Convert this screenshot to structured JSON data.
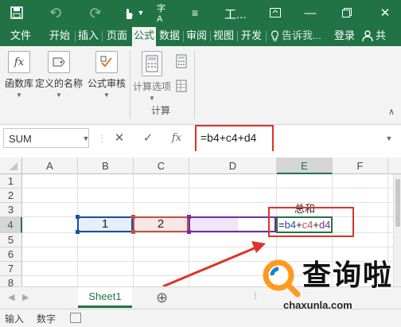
{
  "titlebar": {
    "save_icon": "save-icon",
    "title": "工..."
  },
  "tabs": [
    "文件",
    "开始",
    "插入",
    "页面",
    "公式",
    "数据",
    "审阅",
    "视图",
    "开发"
  ],
  "tell_me": "告诉我...",
  "login": "登录",
  "share_icon_label": "共",
  "ribbon": {
    "function_library": "函数库",
    "defined_names": "定义的名称",
    "formula_auditing": "公式审核",
    "calc_options": "计算选项",
    "calculation_group": "计算"
  },
  "formula_bar": {
    "name_box": "SUM",
    "cancel": "✕",
    "enter": "✓",
    "fx": "fx",
    "formula": "=b4+c4+d4"
  },
  "grid": {
    "columns": [
      "A",
      "B",
      "C",
      "D",
      "E",
      "F"
    ],
    "rows": [
      "1",
      "2",
      "3",
      "4",
      "5",
      "6",
      "7",
      "8"
    ],
    "b4": "1",
    "c4": "2",
    "e3": "总和",
    "e4_formula": "=b4+c4+d4",
    "e4_parts": [
      "=",
      "b4",
      "+",
      "c4",
      "+",
      "d4"
    ]
  },
  "sheet_tab": "Sheet1",
  "add_sheet": "⊕",
  "status": {
    "mode": "输入",
    "num": "数字"
  },
  "watermark": {
    "brand": "查询啦",
    "domain": "chaxunla.com"
  },
  "colors": {
    "excel_green": "#217346",
    "highlight_red": "#e0312a",
    "ref_blue": "#1f4e9c",
    "ref_red": "#c0504d",
    "ref_purple": "#7030a0"
  }
}
